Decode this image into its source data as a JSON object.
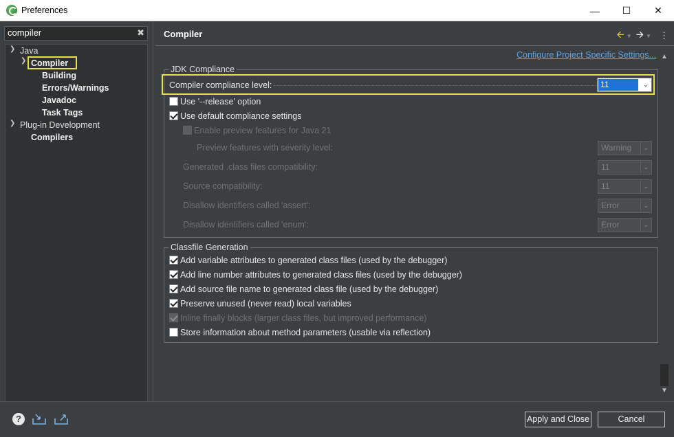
{
  "window": {
    "title": "Preferences",
    "controls": [
      "minimize",
      "maximize",
      "close"
    ]
  },
  "filter": {
    "value": "compiler"
  },
  "tree": {
    "java": "Java",
    "compiler": "Compiler",
    "building": "Building",
    "errors": "Errors/Warnings",
    "javadoc": "Javadoc",
    "tasktags": "Task Tags",
    "plugin": "Plug-in Development",
    "compilers": "Compilers"
  },
  "page": {
    "title": "Compiler",
    "link": "Configure Project Specific Settings..."
  },
  "jdk": {
    "group_label": "JDK Compliance",
    "compliance_label": "Compiler compliance level:",
    "compliance_value": "11",
    "release_label": "Use '--release' option",
    "release_checked": false,
    "default_label": "Use default compliance settings",
    "default_checked": true,
    "preview_label": "Enable preview features for Java 21",
    "severity_label": "Preview features with severity level:",
    "severity_value": "Warning",
    "generated_label": "Generated .class files compatibility:",
    "generated_value": "11",
    "source_label": "Source compatibility:",
    "source_value": "11",
    "assert_label": "Disallow identifiers called 'assert':",
    "assert_value": "Error",
    "enum_label": "Disallow identifiers called 'enum':",
    "enum_value": "Error"
  },
  "classfile": {
    "group_label": "Classfile Generation",
    "items": [
      {
        "label": "Add variable attributes to generated class files (used by the debugger)",
        "checked": true,
        "enabled": true
      },
      {
        "label": "Add line number attributes to generated class files (used by the debugger)",
        "checked": true,
        "enabled": true
      },
      {
        "label": "Add source file name to generated class file (used by the debugger)",
        "checked": true,
        "enabled": true
      },
      {
        "label": "Preserve unused (never read) local variables",
        "checked": true,
        "enabled": true
      },
      {
        "label": "Inline finally blocks (larger class files, but improved performance)",
        "checked": true,
        "enabled": false
      },
      {
        "label": "Store information about method parameters (usable via reflection)",
        "checked": false,
        "enabled": true
      }
    ]
  },
  "buttons": {
    "apply_close": "Apply and Close",
    "cancel": "Cancel"
  },
  "icons": {
    "help": "?",
    "import": "import-icon",
    "export": "export-icon",
    "help_name": "help-icon"
  },
  "colors": {
    "highlight": "#e8e04a",
    "selection": "#1e72d8",
    "link": "#5ea1de"
  }
}
